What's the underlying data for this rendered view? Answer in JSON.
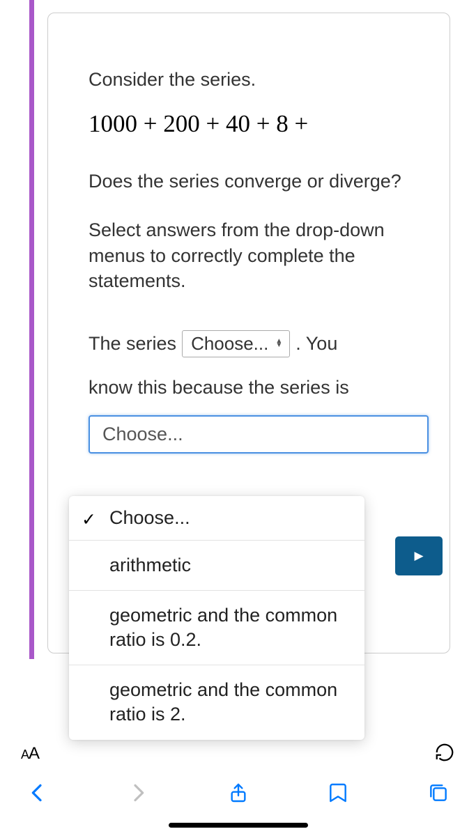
{
  "content": {
    "prompt1": "Consider the series.",
    "math": "1000 + 200 + 40 + 8 +",
    "prompt2": "Does the series converge or diverge?",
    "prompt3": "Select answers from the drop-down menus to correctly complete the statements.",
    "sentence_part1": "The series",
    "dropdown1_label": "Choose...",
    "sentence_part2": ". You",
    "sentence2": "know this because the series is",
    "dropdown2_label": "Choose..."
  },
  "dropdown_options": {
    "placeholder": "Choose...",
    "opt_arithmetic": "arithmetic",
    "opt_geo_02": "geometric and the common ratio is 0.2.",
    "opt_geo_2": "geometric and the common ratio is 2."
  },
  "toolbar": {
    "aa_small": "A",
    "aa_large": "A"
  },
  "next_play": "▶"
}
